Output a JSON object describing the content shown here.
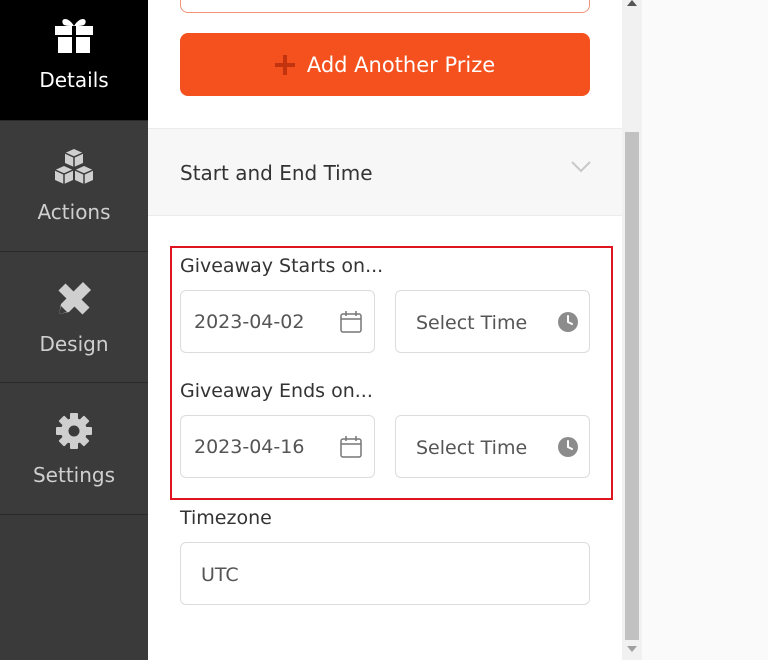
{
  "sidebar": {
    "items": [
      {
        "label": "Details",
        "icon": "gift-icon",
        "active": true
      },
      {
        "label": "Actions",
        "icon": "cubes-icon",
        "active": false
      },
      {
        "label": "Design",
        "icon": "pencil-ruler-icon",
        "active": false
      },
      {
        "label": "Settings",
        "icon": "gear-icon",
        "active": false
      }
    ]
  },
  "main": {
    "add_prize_label": "Add Another Prize",
    "section_title": "Start and End Time",
    "start": {
      "label": "Giveaway Starts on...",
      "date": "2023-04-02",
      "time_placeholder": "Select Time"
    },
    "end": {
      "label": "Giveaway Ends on...",
      "date": "2023-04-16",
      "time_placeholder": "Select Time"
    },
    "timezone": {
      "label": "Timezone",
      "value": "UTC"
    }
  },
  "colors": {
    "accent": "#f4511e",
    "highlight": "#e0141e",
    "sidebar_bg": "#3b3b3b",
    "sidebar_active_bg": "#000000"
  }
}
